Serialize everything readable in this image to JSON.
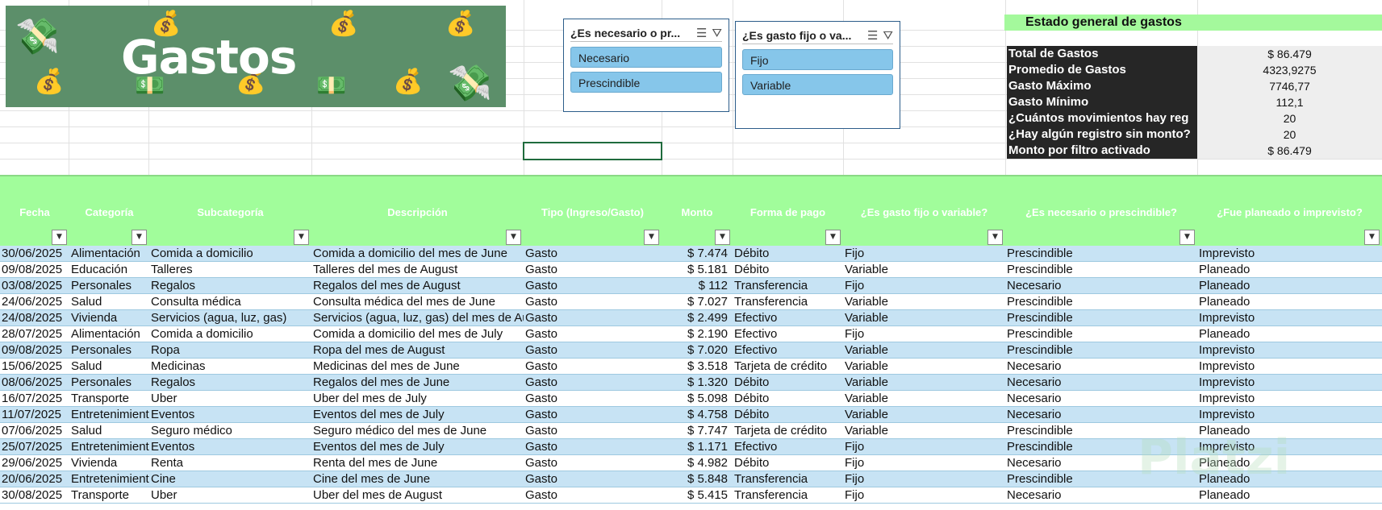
{
  "banner": {
    "title": "Gastos"
  },
  "slicers": [
    {
      "title": "¿Es necesario o pr...",
      "items": [
        "Necesario",
        "Prescindible"
      ]
    },
    {
      "title": "¿Es gasto fijo o va...",
      "items": [
        "Fijo",
        "Variable"
      ]
    }
  ],
  "summary": {
    "title": "Estado general de gastos",
    "rows": [
      {
        "label": "Total de Gastos",
        "value": "$ 86.479"
      },
      {
        "label": "Promedio de Gastos",
        "value": "4323,9275"
      },
      {
        "label": "Gasto Máximo",
        "value": "7746,77"
      },
      {
        "label": "Gasto Mínimo",
        "value": "112,1"
      },
      {
        "label": "¿Cuántos movimientos hay reg",
        "value": "20"
      },
      {
        "label": "¿Hay algún registro sin monto?",
        "value": "20"
      },
      {
        "label": "Monto por filtro activado",
        "value": "$ 86.479"
      }
    ]
  },
  "table": {
    "headers": [
      "Fecha",
      "Categoría",
      "Subcategoría",
      "Descripción",
      "Tipo (Ingreso/Gasto)",
      "Monto",
      "Forma de pago",
      "¿Es gasto fijo o variable?",
      "¿Es necesario o prescindible?",
      "¿Fue planeado o imprevisto?"
    ],
    "rows": [
      [
        "30/06/2025",
        "Alimentación",
        "Comida a domicilio",
        "Comida a domicilio del mes de June",
        "Gasto",
        "$ 7.474",
        "Débito",
        "Fijo",
        "Prescindible",
        "Imprevisto"
      ],
      [
        "09/08/2025",
        "Educación",
        "Talleres",
        "Talleres del mes de August",
        "Gasto",
        "$ 5.181",
        "Débito",
        "Variable",
        "Prescindible",
        "Planeado"
      ],
      [
        "03/08/2025",
        "Personales",
        "Regalos",
        "Regalos del mes de August",
        "Gasto",
        "$ 112",
        "Transferencia",
        "Fijo",
        "Necesario",
        "Planeado"
      ],
      [
        "24/06/2025",
        "Salud",
        "Consulta médica",
        "Consulta médica del mes de June",
        "Gasto",
        "$ 7.027",
        "Transferencia",
        "Variable",
        "Prescindible",
        "Planeado"
      ],
      [
        "24/08/2025",
        "Vivienda",
        "Servicios (agua, luz, gas)",
        "Servicios (agua, luz, gas) del mes de August",
        "Gasto",
        "$ 2.499",
        "Efectivo",
        "Variable",
        "Prescindible",
        "Imprevisto"
      ],
      [
        "28/07/2025",
        "Alimentación",
        "Comida a domicilio",
        "Comida a domicilio del mes de July",
        "Gasto",
        "$ 2.190",
        "Efectivo",
        "Fijo",
        "Prescindible",
        "Planeado"
      ],
      [
        "09/08/2025",
        "Personales",
        "Ropa",
        "Ropa del mes de August",
        "Gasto",
        "$ 7.020",
        "Efectivo",
        "Variable",
        "Prescindible",
        "Imprevisto"
      ],
      [
        "15/06/2025",
        "Salud",
        "Medicinas",
        "Medicinas del mes de June",
        "Gasto",
        "$ 3.518",
        "Tarjeta de crédito",
        "Variable",
        "Necesario",
        "Imprevisto"
      ],
      [
        "08/06/2025",
        "Personales",
        "Regalos",
        "Regalos del mes de June",
        "Gasto",
        "$ 1.320",
        "Débito",
        "Variable",
        "Necesario",
        "Imprevisto"
      ],
      [
        "16/07/2025",
        "Transporte",
        "Uber",
        "Uber del mes de July",
        "Gasto",
        "$ 5.098",
        "Débito",
        "Variable",
        "Necesario",
        "Imprevisto"
      ],
      [
        "11/07/2025",
        "Entretenimiento",
        "Eventos",
        "Eventos del mes de July",
        "Gasto",
        "$ 4.758",
        "Débito",
        "Variable",
        "Necesario",
        "Imprevisto"
      ],
      [
        "07/06/2025",
        "Salud",
        "Seguro médico",
        "Seguro médico del mes de June",
        "Gasto",
        "$ 7.747",
        "Tarjeta de crédito",
        "Variable",
        "Prescindible",
        "Planeado"
      ],
      [
        "25/07/2025",
        "Entretenimiento",
        "Eventos",
        "Eventos del mes de July",
        "Gasto",
        "$ 1.171",
        "Efectivo",
        "Fijo",
        "Prescindible",
        "Imprevisto"
      ],
      [
        "29/06/2025",
        "Vivienda",
        "Renta",
        "Renta del mes de June",
        "Gasto",
        "$ 4.982",
        "Débito",
        "Fijo",
        "Necesario",
        "Planeado"
      ],
      [
        "20/06/2025",
        "Entretenimiento",
        "Cine",
        "Cine del mes de June",
        "Gasto",
        "$ 5.848",
        "Transferencia",
        "Fijo",
        "Prescindible",
        "Planeado"
      ],
      [
        "30/08/2025",
        "Transporte",
        "Uber",
        "Uber del mes de August",
        "Gasto",
        "$ 5.415",
        "Transferencia",
        "Fijo",
        "Necesario",
        "Planeado"
      ]
    ]
  },
  "watermark": "Platzi",
  "colors": {
    "banner": "#5c8f6a",
    "header": "#a1fd9b",
    "row_alt": "#c7e3f4",
    "slicer_item": "#86c6ea",
    "summary_label_bg": "#262626"
  }
}
